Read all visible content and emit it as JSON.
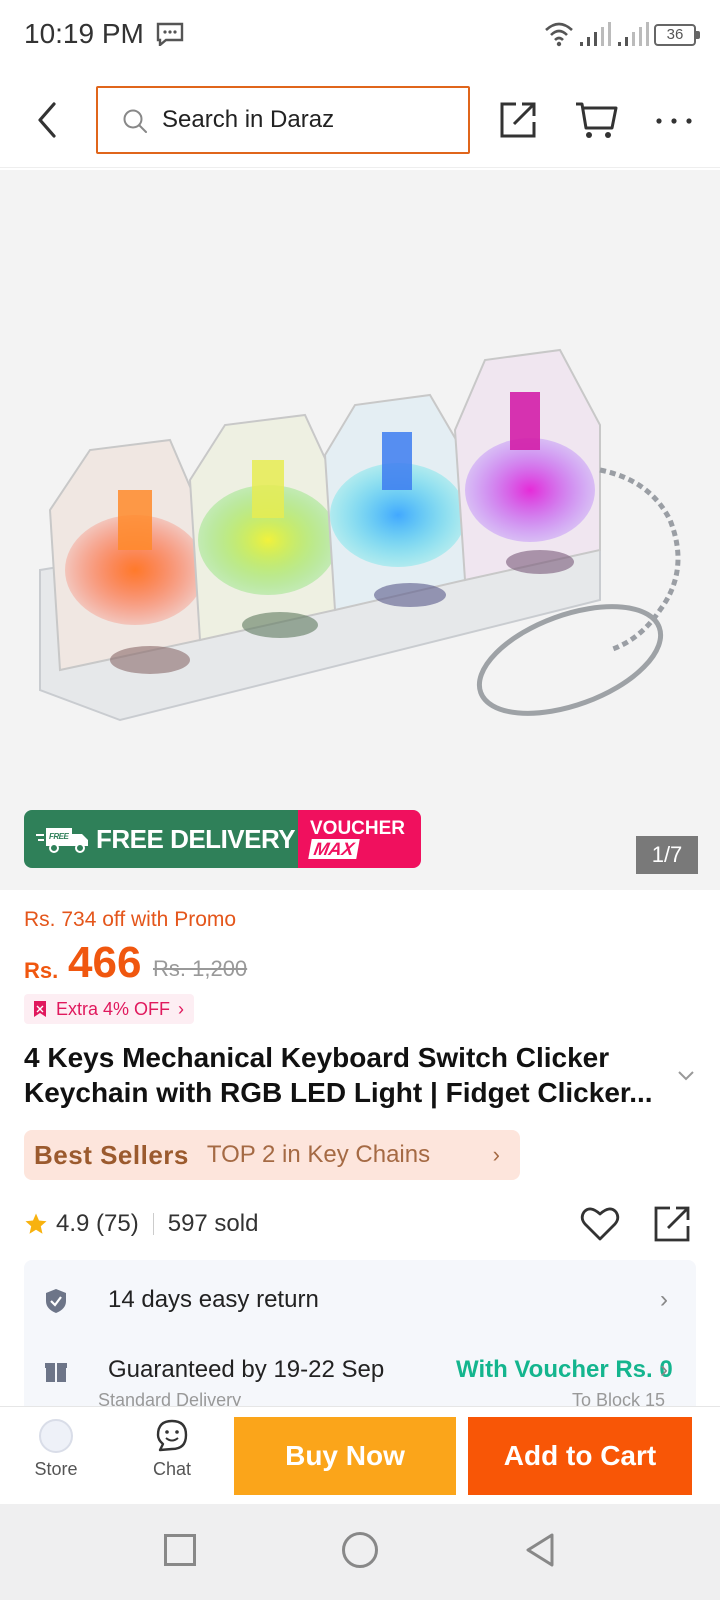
{
  "status_bar": {
    "time": "10:19 PM",
    "battery": "36"
  },
  "header": {
    "search_placeholder": "Search in Daraz"
  },
  "hero": {
    "badge_free": "FREE DELIVERY",
    "badge_free_small": "FREE",
    "badge_voucher": "VOUCHER",
    "badge_max": "MAX",
    "pager": "1/7"
  },
  "price": {
    "promo": "Rs. 734 off with Promo",
    "currency": "Rs.",
    "current": "466",
    "original": "Rs. 1,200",
    "extra_off": "Extra 4% OFF"
  },
  "product": {
    "title": "4 Keys Mechanical Keyboard Switch Clicker Keychain with RGB LED Light | Fidget Clicker...",
    "best_logo": "Best Sellers",
    "best_text": "TOP 2 in Key Chains",
    "rating": "4.9 (75)",
    "sold": "597 sold"
  },
  "services": {
    "return": "14 days easy return",
    "guarantee": "Guaranteed by 19-22 Sep",
    "voucher": "With Voucher Rs. 0",
    "standard": "Standard Delivery",
    "to_block": "To Block 15"
  },
  "actions": {
    "store": "Store",
    "chat": "Chat",
    "buy_now": "Buy Now",
    "add_to_cart": "Add to Cart"
  },
  "colors": {
    "orange": "#f85606",
    "yellow": "#fba51a",
    "green_badge": "#2f8059",
    "pink": "#f0105e",
    "teal": "#14b58e"
  }
}
